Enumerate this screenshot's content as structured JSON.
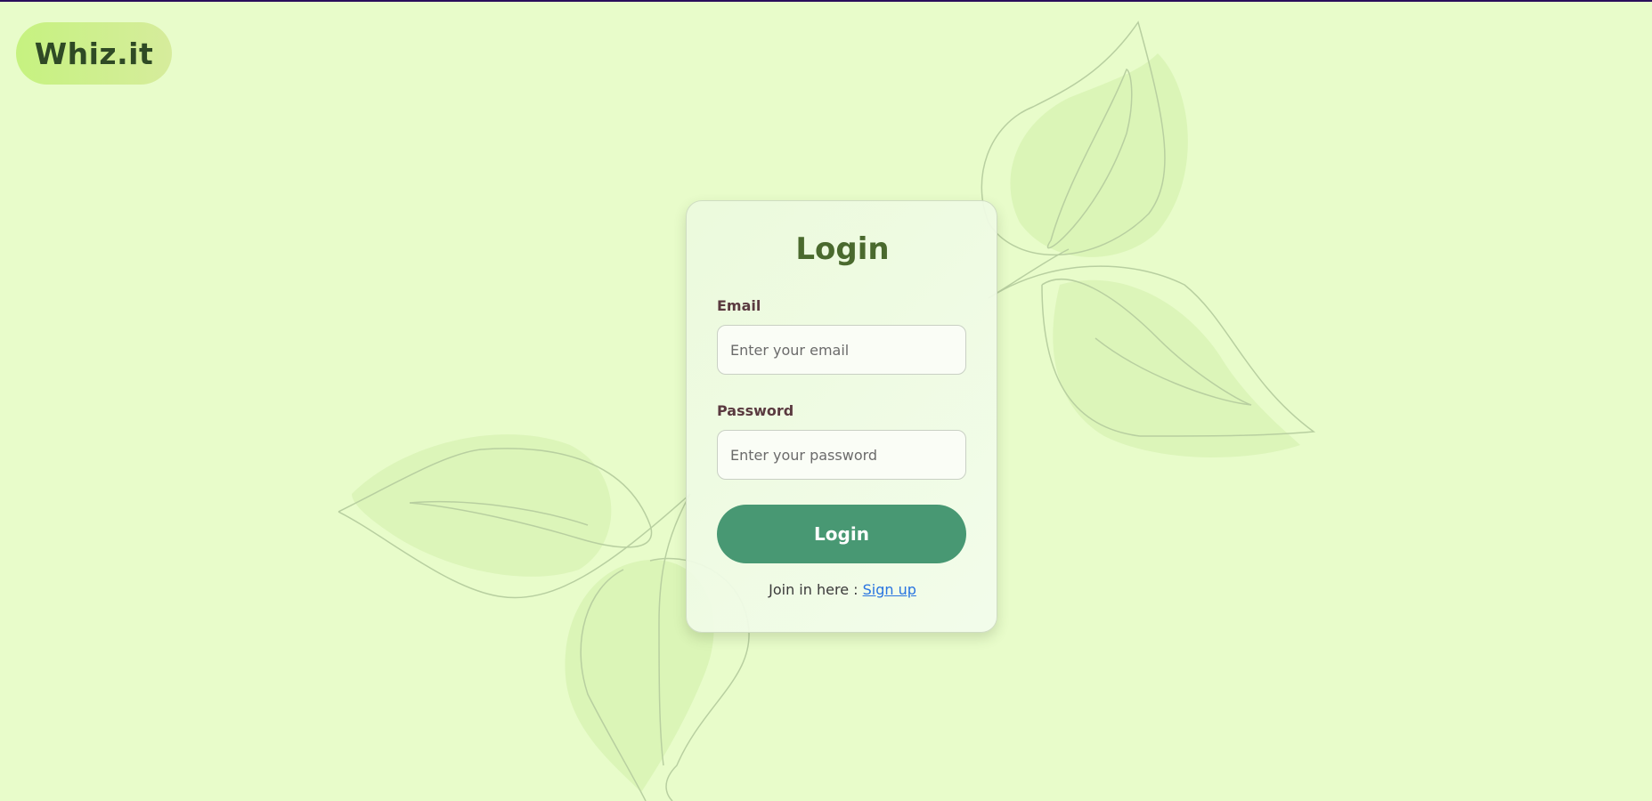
{
  "brand": {
    "name": "Whiz.it"
  },
  "login_form": {
    "title": "Login",
    "email": {
      "label": "Email",
      "placeholder": "Enter your email",
      "value": ""
    },
    "password": {
      "label": "Password",
      "placeholder": "Enter your password",
      "value": ""
    },
    "submit_label": "Login",
    "signup_prompt": "Join in here : ",
    "signup_link_label": "Sign up"
  },
  "colors": {
    "background": "#e8fcca",
    "logo_pill": "#c6f280",
    "logo_text": "#2f4a25",
    "title_text": "#4a6a2e",
    "label_text": "#5a3a40",
    "button": "#489873",
    "link": "#2874e0"
  },
  "icons": {
    "background_decoration": "leaf-sprig-illustration"
  }
}
